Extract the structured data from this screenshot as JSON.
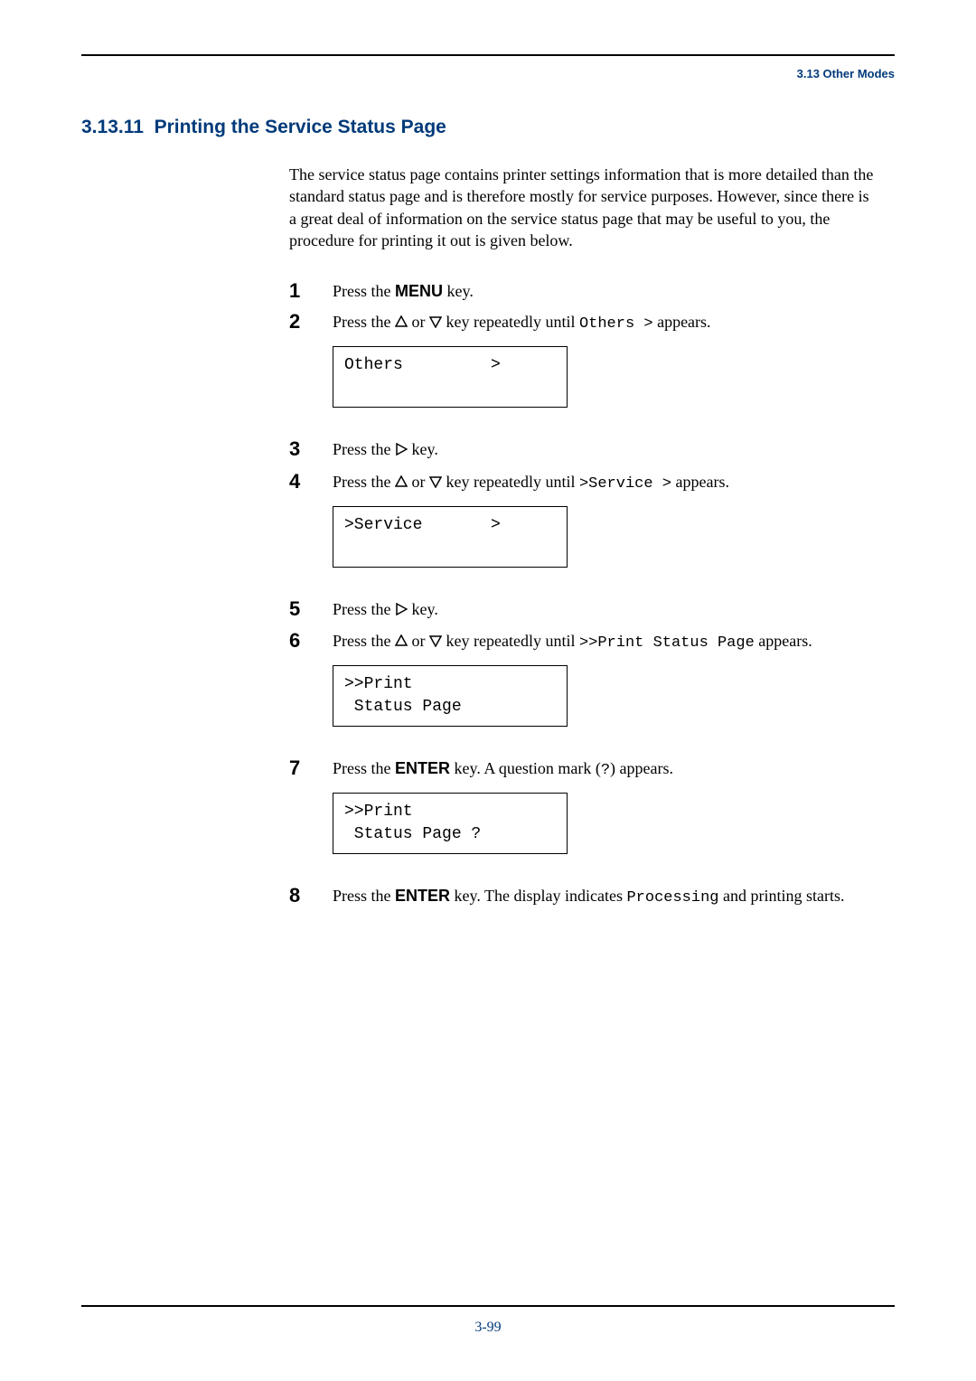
{
  "header": {
    "section_label": "3.13 Other Modes"
  },
  "title": {
    "number": "3.13.11",
    "text": "Printing the Service Status Page"
  },
  "intro": "The service status page contains printer settings information that is more detailed than the standard status page and is therefore mostly for service purposes. However, since there is a great deal of information on the service status page that may be useful to you, the procedure for printing it out is given below.",
  "steps": [
    {
      "num": "1",
      "prefix": "Press the ",
      "bold": "MENU",
      "suffix": " key."
    },
    {
      "num": "2",
      "prefix": "Press the ",
      "mid": " key repeatedly until ",
      "mono": "Others >",
      "suffix": " appears.",
      "lcd": "Others         >"
    },
    {
      "num": "3",
      "prefix": "Press the ",
      "suffix": " key."
    },
    {
      "num": "4",
      "prefix": "Press the ",
      "mid": " key repeatedly until ",
      "mono": ">Service >",
      "suffix": " appears.",
      "lcd": ">Service       >"
    },
    {
      "num": "5",
      "prefix": "Press the ",
      "suffix": " key."
    },
    {
      "num": "6",
      "prefix": "Press the ",
      "mid": " key repeatedly until ",
      "mono": ">>Print Status Page",
      "suffix": " appears.",
      "lcd": ">>Print\n Status Page"
    },
    {
      "num": "7",
      "prefix": "Press the ",
      "bold": "ENTER",
      "mid": " key. A question mark (",
      "mono": "?",
      "suffix": ") appears.",
      "lcd": ">>Print\n Status Page ?"
    },
    {
      "num": "8",
      "prefix": "Press the ",
      "bold": "ENTER",
      "mid": " key. The display indicates ",
      "mono": "Processing",
      "suffix": " and printing starts."
    }
  ],
  "page_number": "3-99"
}
